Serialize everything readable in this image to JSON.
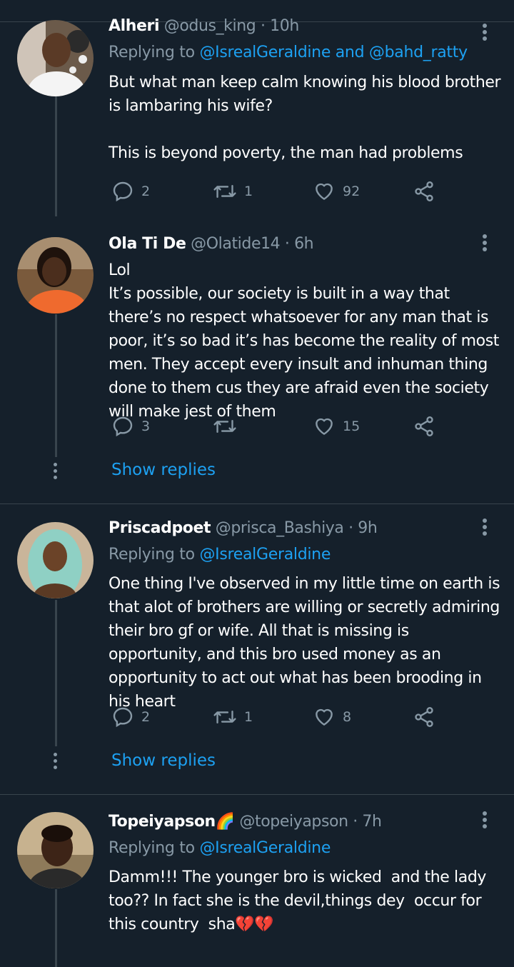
{
  "tweets": [
    {
      "name": "Alheri",
      "handle": "@odus_king",
      "time": "· 10h",
      "replying_prefix": "Replying to",
      "replying_to": "@IsrealGeraldine and @bahd_ratty",
      "text": "But what man keep calm knowing his blood brother is lambaring his wife?\n\nThis is beyond poverty, the man had problems",
      "replies": "2",
      "retweets": "1",
      "likes": "92"
    },
    {
      "name": "Ola Ti De",
      "handle": "@Olatide14",
      "time": "· 6h",
      "text": "Lol\nIt’s possible, our society is built in a way that there’s no respect whatsoever for any man that is poor, it’s so bad it’s has become the reality of most men. They accept every insult and inhuman thing done to them cus they are afraid even the society will make jest of them",
      "replies": "3",
      "retweets": "",
      "likes": "15",
      "show_replies": "Show replies"
    },
    {
      "name": "Priscadpoet",
      "handle": "@prisca_Bashiya",
      "time": "· 9h",
      "replying_prefix": "Replying to",
      "replying_to": "@IsrealGeraldine",
      "text": "One thing I've observed in my little time on earth is that alot of brothers are willing or secretly admiring their bro gf or wife. All that is missing is opportunity, and this bro used money as an opportunity to act out what has been brooding in his heart",
      "replies": "2",
      "retweets": "1",
      "likes": "8",
      "show_replies": "Show replies"
    },
    {
      "name": "Topeiyapson🌈",
      "handle": "@topeiyapson",
      "time": "· 7h",
      "replying_prefix": "Replying to",
      "replying_to": "@IsrealGeraldine",
      "text": "Damm!!! The younger bro is wicked  and the lady too?? In fact she is the devil,things dey  occur for this country  sha💔💔"
    }
  ],
  "icons": {
    "reply": "reply-icon",
    "retweet": "retweet-icon",
    "like": "heart-icon",
    "share": "share-icon",
    "more": "more-vertical-icon"
  },
  "colors": {
    "background": "#15202b",
    "muted": "#8899a6",
    "link": "#1da1f2",
    "divider": "#38444d"
  }
}
